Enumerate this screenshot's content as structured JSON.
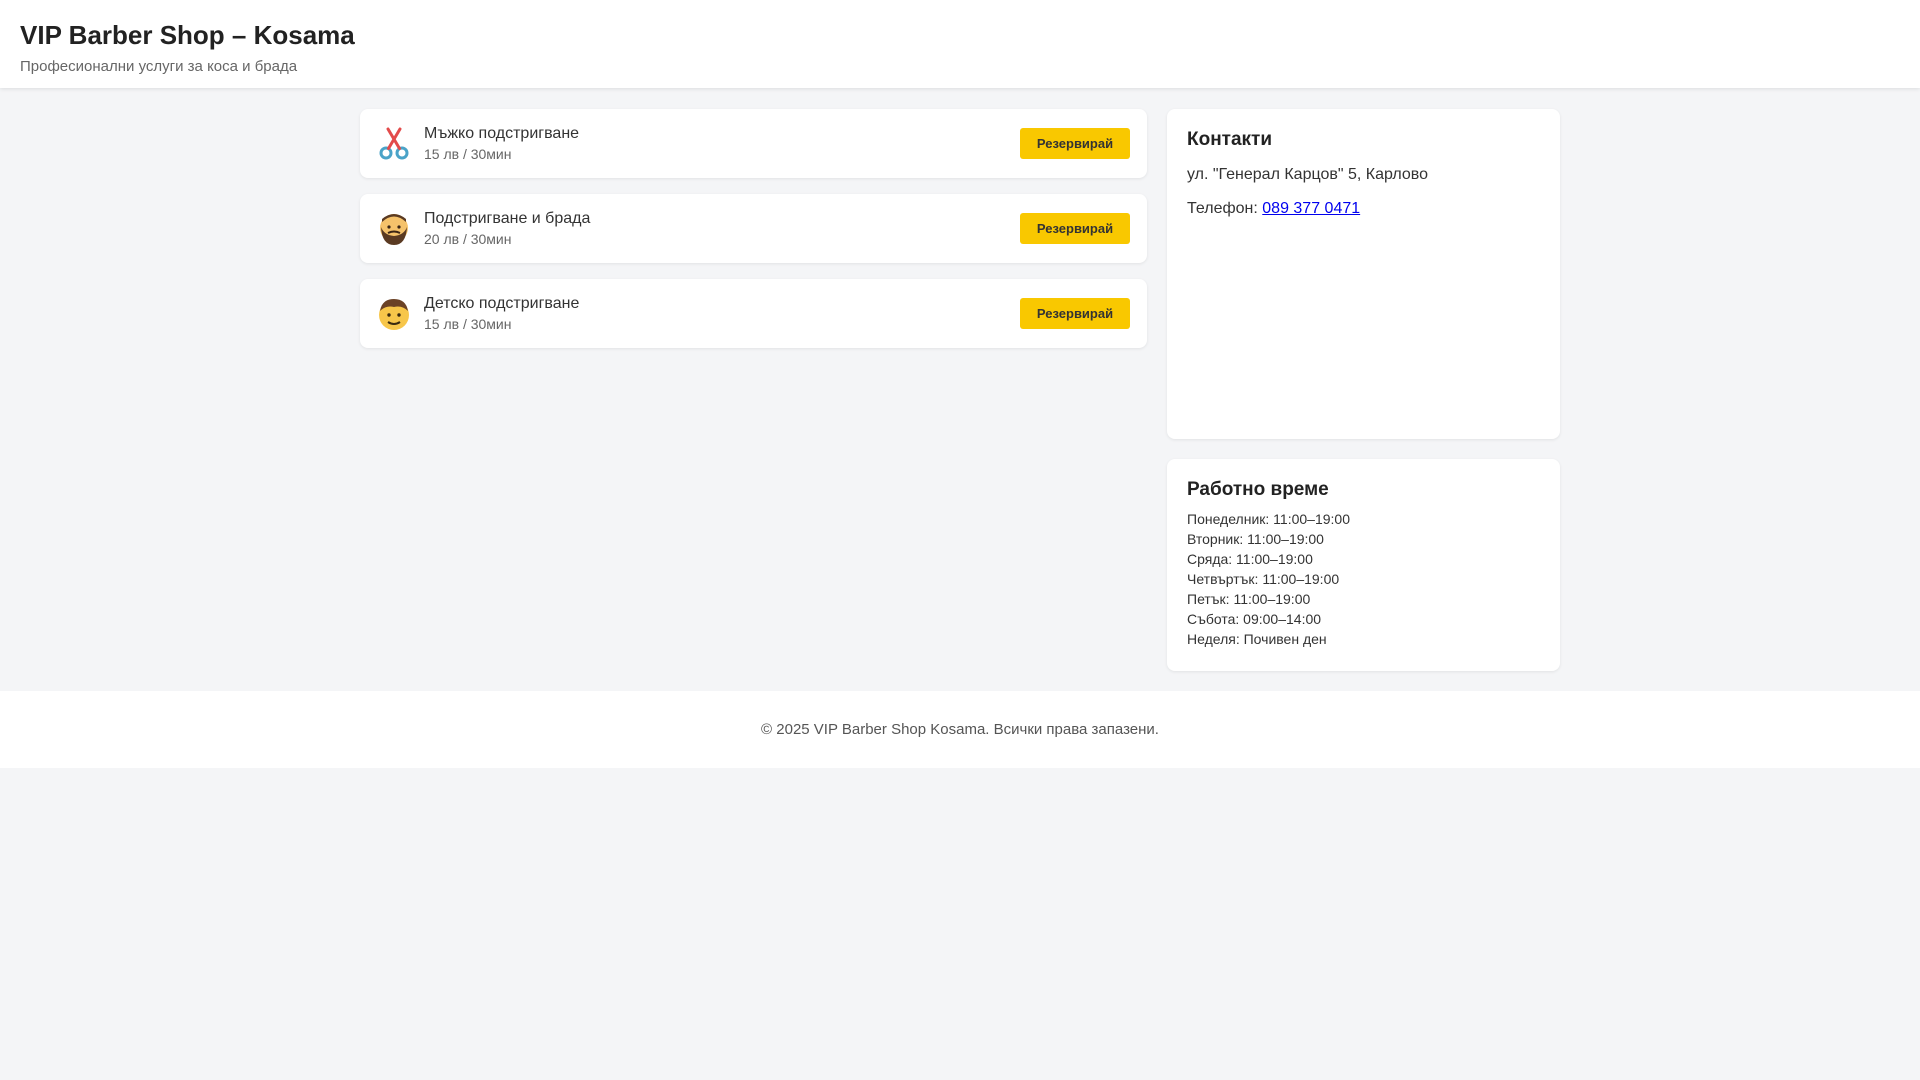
{
  "header": {
    "title": "VIP Barber Shop – Kosama",
    "subtitle": "Професионални услуги за коса и брада"
  },
  "services": [
    {
      "icon": "scissors-icon",
      "name": "Мъжко подстригване",
      "meta": "15 лв / 30мин",
      "button": "Резервирай"
    },
    {
      "icon": "bearded-man-icon",
      "name": "Подстригване и брада",
      "meta": "20 лв / 30мин",
      "button": "Резервирай"
    },
    {
      "icon": "boy-icon",
      "name": "Детско подстригване",
      "meta": "15 лв / 30мин",
      "button": "Резервирай"
    }
  ],
  "contacts": {
    "title": "Контакти",
    "address": "ул. \"Генерал Карцов\" 5, Карлово",
    "phone_label": "Телефон: ",
    "phone": "089 377 0471"
  },
  "hours": {
    "title": "Работно време",
    "days": [
      "Понеделник: 11:00–19:00",
      "Вторник: 11:00–19:00",
      "Сряда: 11:00–19:00",
      "Четвъртък: 11:00–19:00",
      "Петък: 11:00–19:00",
      "Събота: 09:00–14:00",
      "Неделя: Почивен ден"
    ]
  },
  "footer": {
    "text": "© 2025 VIP Barber Shop Kosama. Всички права запазени."
  },
  "colors": {
    "accent": "#f9c800",
    "link": "#0000ee",
    "background": "#f4f5f7"
  }
}
